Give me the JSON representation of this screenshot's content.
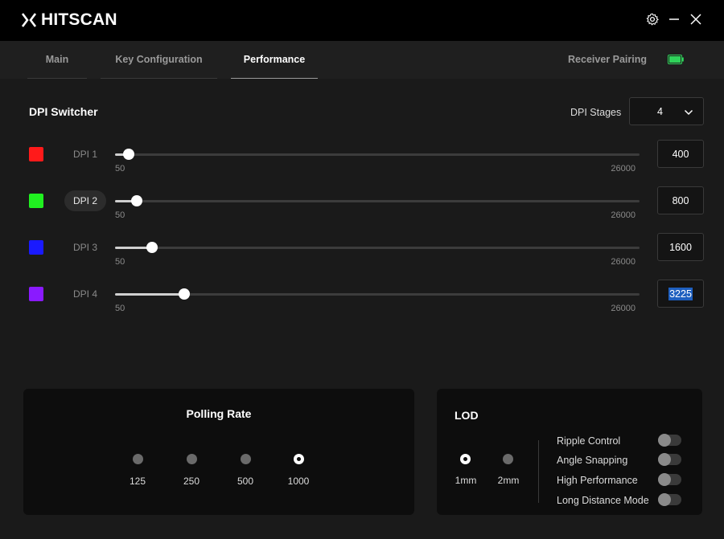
{
  "app": {
    "title": "HITSCAN"
  },
  "tabs": [
    {
      "label": "Main",
      "active": false
    },
    {
      "label": "Key Configuration",
      "active": false
    },
    {
      "label": "Performance",
      "active": true
    }
  ],
  "header_right": {
    "pairing_label": "Receiver Pairing",
    "battery_color": "#2fd35a"
  },
  "dpi": {
    "title": "DPI Switcher",
    "stages_label": "DPI Stages",
    "stages_value": "4",
    "min": "50",
    "max": "26000",
    "rows": [
      {
        "label": "DPI 1",
        "color": "#ff1a1a",
        "value": "400",
        "fraction": 0.026,
        "highlighted": false
      },
      {
        "label": "DPI 2",
        "color": "#20f020",
        "value": "800",
        "fraction": 0.041,
        "highlighted": true
      },
      {
        "label": "DPI 3",
        "color": "#1a1aff",
        "value": "1600",
        "fraction": 0.07,
        "highlighted": false
      },
      {
        "label": "DPI 4",
        "color": "#8a1aff",
        "value": "3225",
        "fraction": 0.132,
        "highlighted": false,
        "selected_text": true
      }
    ]
  },
  "polling": {
    "title": "Polling Rate",
    "options": [
      "125",
      "250",
      "500",
      "1000"
    ],
    "selected": "1000"
  },
  "lod": {
    "title": "LOD",
    "options": [
      "1mm",
      "2mm"
    ],
    "selected": "1mm",
    "toggles": [
      {
        "label": "Ripple Control",
        "on": false
      },
      {
        "label": "Angle Snapping",
        "on": false
      },
      {
        "label": "High Performance",
        "on": false
      },
      {
        "label": "Long Distance Mode",
        "on": false
      }
    ]
  }
}
